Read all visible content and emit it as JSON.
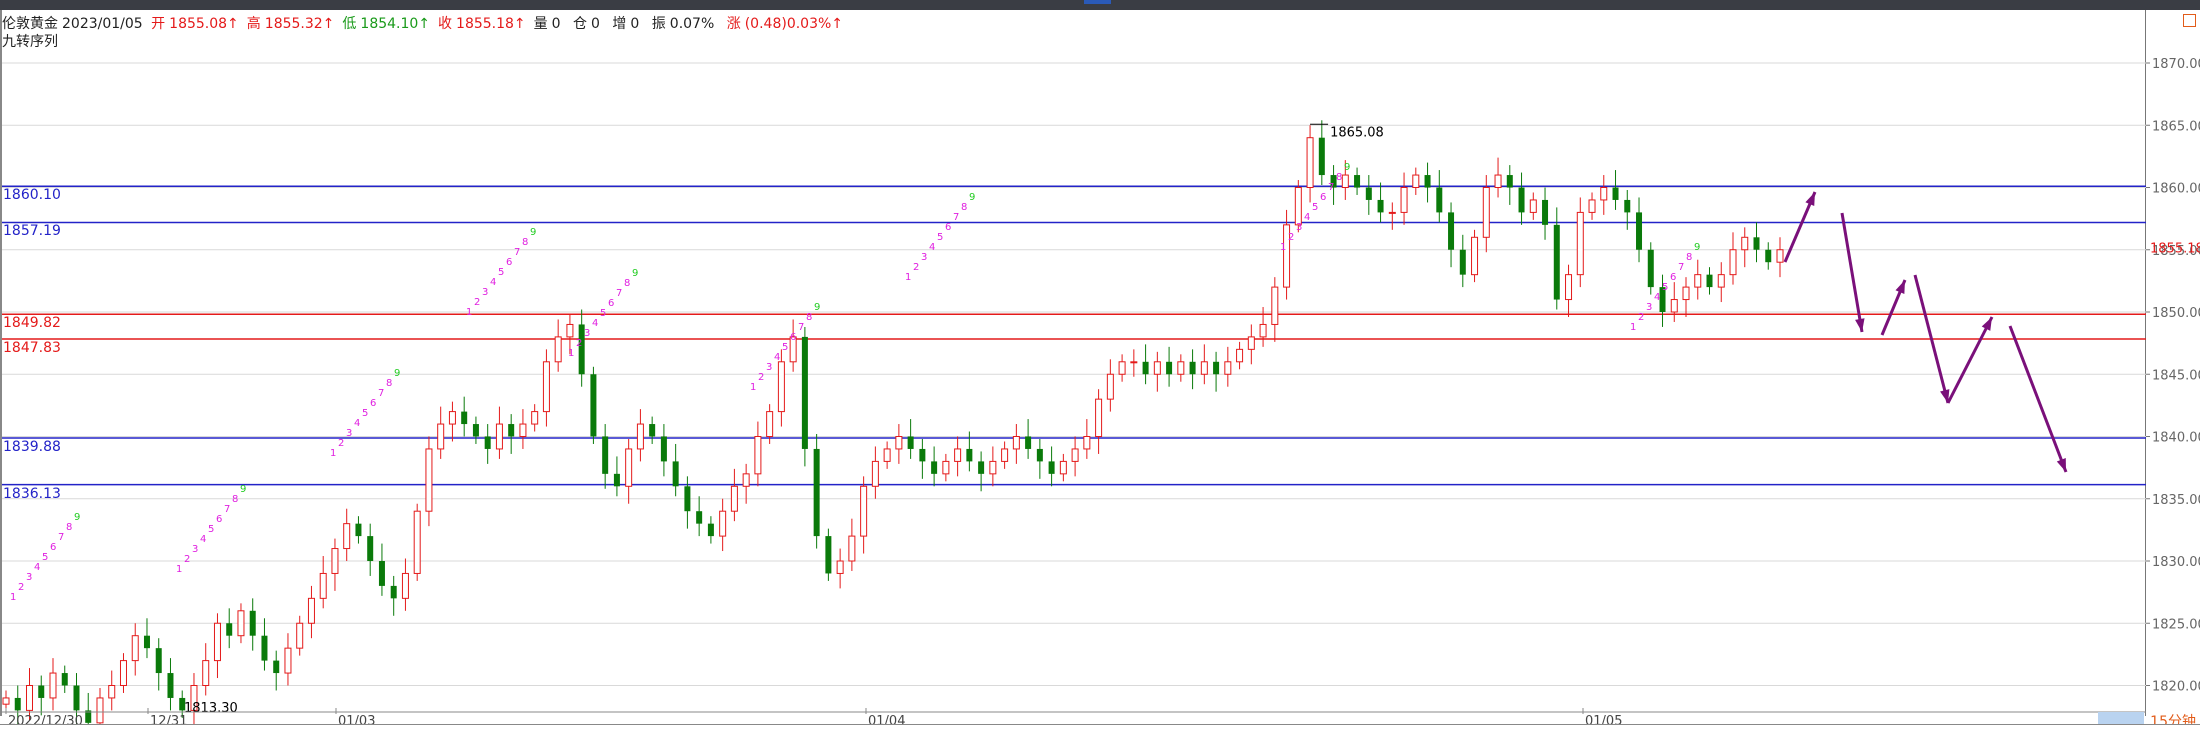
{
  "header": {
    "symbol": "伦敦黄金",
    "date": "2023/01/05",
    "open_label": "开",
    "open": "1855.08↑",
    "high_label": "高",
    "high": "1855.32↑",
    "low_label": "低",
    "low": "1854.10↑",
    "close_label": "收",
    "close": "1855.18↑",
    "volume_label": "量",
    "volume": "0",
    "oi_label": "仓",
    "oi": "0",
    "incr_label": "增",
    "incr": "0",
    "amp_label": "振",
    "amp": "0.07%",
    "chg_label": "涨",
    "chg": "(0.48)0.03%↑"
  },
  "indicator_label": "九转序列",
  "levels": [
    {
      "text": "1860.10",
      "price": 1860.1,
      "color": "#2323c8"
    },
    {
      "text": "1857.19",
      "price": 1857.19,
      "color": "#2323c8"
    },
    {
      "text": "1849.82",
      "price": 1849.82,
      "color": "#e41a1a"
    },
    {
      "text": "1847.83",
      "price": 1847.83,
      "color": "#e41a1a"
    },
    {
      "text": "1839.88",
      "price": 1839.88,
      "color": "#2323c8"
    },
    {
      "text": "1836.13",
      "price": 1836.13,
      "color": "#2323c8"
    }
  ],
  "y_axis": {
    "ticks": [
      "1870.00",
      "1865.00",
      "1860.00",
      "1855.00",
      "1850.00",
      "1845.00",
      "1840.00",
      "1835.00",
      "1830.00",
      "1825.00",
      "1820.00"
    ],
    "current": "1855.18",
    "range": [
      1817,
      1874
    ]
  },
  "x_axis": {
    "labels": [
      "2022/12/30",
      "12/31",
      "01/03",
      "01/04",
      "01/05"
    ]
  },
  "annotations": {
    "high_marker": "1865.08",
    "low_marker": "1813.30"
  },
  "interval": "15分钟",
  "colors": {
    "up": "#e41a1a",
    "down": "#0a7a0a",
    "arrow": "#7a107a",
    "count_magenta": "#e020e0",
    "count_green": "#22cc22"
  },
  "chart_data": {
    "type": "candlestick",
    "series": [
      {
        "name": "伦敦黄金",
        "close_values": [
          1819,
          1818,
          1820,
          1819,
          1821,
          1820,
          1818,
          1817,
          1819,
          1820,
          1822,
          1824,
          1823,
          1821,
          1819,
          1818,
          1820,
          1822,
          1825,
          1824,
          1826,
          1824,
          1822,
          1821,
          1823,
          1825,
          1827,
          1829,
          1831,
          1833,
          1832,
          1830,
          1828,
          1827,
          1829,
          1834,
          1839,
          1841,
          1842,
          1841,
          1840,
          1839,
          1841,
          1840,
          1841,
          1842,
          1846,
          1848,
          1849,
          1845,
          1840,
          1837,
          1836,
          1839,
          1841,
          1840,
          1838,
          1836,
          1834,
          1833,
          1832,
          1834,
          1836,
          1837,
          1840,
          1842,
          1846,
          1848,
          1839,
          1832,
          1829,
          1830,
          1832,
          1836,
          1838,
          1839,
          1840,
          1839,
          1838,
          1837,
          1838,
          1839,
          1838,
          1837,
          1838,
          1839,
          1840,
          1839,
          1838,
          1837,
          1838,
          1839,
          1840,
          1843,
          1845,
          1846,
          1846,
          1845,
          1846,
          1845,
          1846,
          1845,
          1846,
          1845,
          1846,
          1847,
          1848,
          1849,
          1852,
          1857,
          1860,
          1864,
          1861,
          1860,
          1861,
          1860,
          1859,
          1858,
          1858,
          1860,
          1861,
          1860,
          1858,
          1855,
          1853,
          1856,
          1860,
          1861,
          1860,
          1858,
          1859,
          1857,
          1851,
          1853,
          1858,
          1859,
          1860,
          1859,
          1858,
          1855,
          1852,
          1850,
          1851,
          1852,
          1853,
          1852,
          1853,
          1855,
          1856,
          1855,
          1854,
          1855
        ]
      }
    ],
    "ylim": [
      1817,
      1874
    ]
  }
}
